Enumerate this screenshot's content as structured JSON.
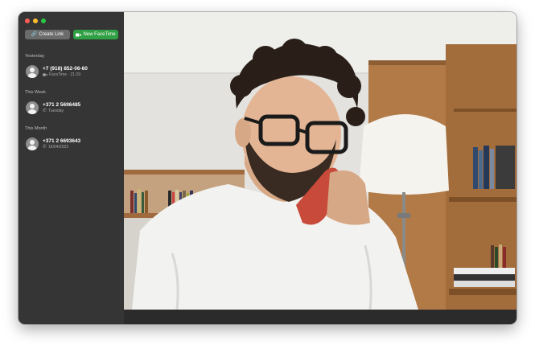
{
  "window": {
    "traffic_lights": [
      "close",
      "minimize",
      "zoom"
    ],
    "colors": {
      "close": "#ff5f57",
      "minimize": "#febc2e",
      "zoom": "#28c840",
      "accent": "#2fa043"
    }
  },
  "toolbar": {
    "create_link_label": "Create Link",
    "create_link_icon": "link-icon",
    "new_facetime_label": "New FaceTime",
    "new_facetime_icon": "video-camera-icon"
  },
  "sections": [
    {
      "title": "Yesterday",
      "calls": [
        {
          "name": "+7 (918) 852-06-60",
          "detail": "FaceTime · 21:29",
          "icon": "video-camera-icon"
        }
      ]
    },
    {
      "title": "This Week",
      "calls": [
        {
          "name": "+371 2 5696485",
          "detail": "Tuesday",
          "icon": "phone-icon"
        }
      ]
    },
    {
      "title": "This Month",
      "calls": [
        {
          "name": "+371 2 6693643",
          "detail": "16/04/2023",
          "icon": "phone-icon"
        }
      ]
    }
  ]
}
